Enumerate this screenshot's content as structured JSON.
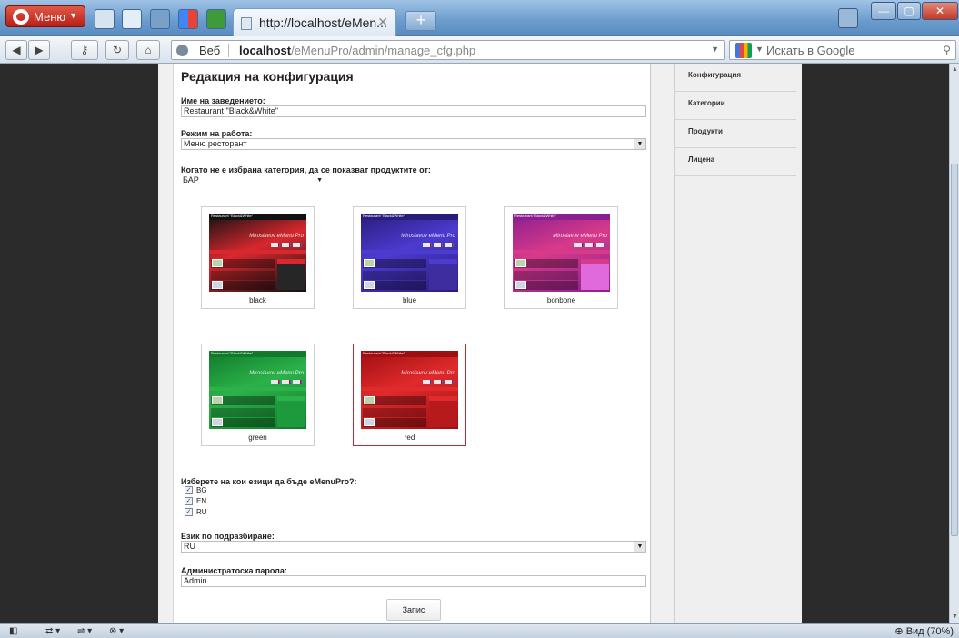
{
  "browser": {
    "menu_label": "Меню",
    "tab_title": "http://localhost/eMen...",
    "address_prefix": "Веб",
    "url_host": "localhost",
    "url_path": "/eMenuPro/admin/manage_cfg.php",
    "search_placeholder": "Искать в Google",
    "zoom_label": "Вид (70%)"
  },
  "page": {
    "title": "Редакция на конфигурация",
    "fields": {
      "name_label": "Име на заведението:",
      "name_value": "Restaurant \"Black&White\"",
      "mode_label": "Режим на работа:",
      "mode_value": "Меню ресторант",
      "category_label": "Когато не е избрана категория, да се показват продуктите от:",
      "category_value": "БАР",
      "langs_label": "Изберете на кои езици да бъде eMenuPro?:",
      "default_lang_label": "Език по подразбиране:",
      "default_lang_value": "RU",
      "password_label": "Администратоска парола:",
      "password_value": "Admin"
    },
    "languages": [
      {
        "code": "BG",
        "checked": true
      },
      {
        "code": "EN",
        "checked": true
      },
      {
        "code": "RU",
        "checked": true
      }
    ],
    "themes": [
      {
        "name": "black",
        "header": "Restaurant \"Black&White\"",
        "brand": "Miroslavov eMenu Pro",
        "selected": false,
        "colors": {
          "bg": "#111111",
          "accent": "#d8282e",
          "side": "#262626"
        }
      },
      {
        "name": "blue",
        "header": "Restaurant \"Black&White\"",
        "brand": "Miroslavov eMenu Pro",
        "selected": false,
        "colors": {
          "bg": "#2a1c7a",
          "accent": "#4c3bd0",
          "side": "#3d2d9e"
        }
      },
      {
        "name": "bonbone",
        "header": "Restaurant \"Black&White\"",
        "brand": "Miroslavov eMenu Pro",
        "selected": false,
        "colors": {
          "bg": "#8a1f8f",
          "accent": "#d83a8a",
          "side": "#e06adc"
        }
      },
      {
        "name": "green",
        "header": "Restaurant \"Black&White\"",
        "brand": "Miroslavov eMenu Pro",
        "selected": false,
        "colors": {
          "bg": "#0f7a2a",
          "accent": "#2cb24a",
          "side": "#1d9a3b"
        }
      },
      {
        "name": "red",
        "header": "Restaurant \"Black&White\"",
        "brand": "Miroslavov eMenu Pro",
        "selected": true,
        "colors": {
          "bg": "#9e0f12",
          "accent": "#e02a2c",
          "side": "#b71a1d"
        }
      }
    ],
    "save_label": "Запис"
  },
  "sidebar": {
    "items": [
      "Конфигурация",
      "Категории",
      "Продукти",
      "Лицена"
    ]
  }
}
